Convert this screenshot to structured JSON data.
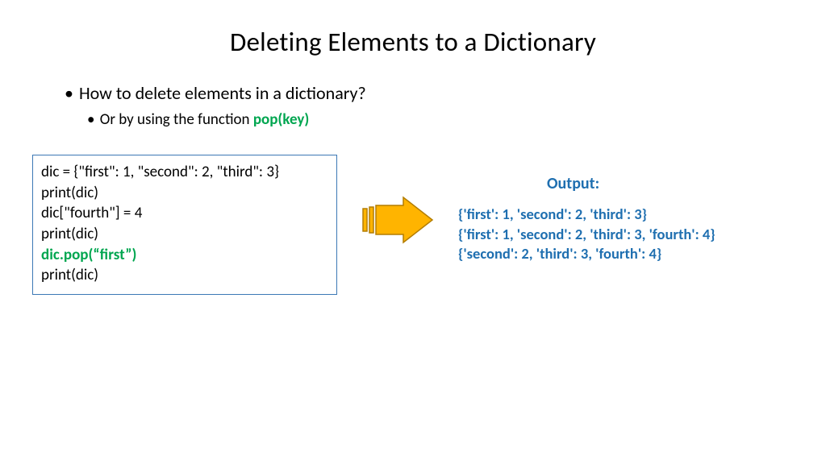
{
  "title": "Deleting Elements to a Dictionary",
  "bullets": {
    "main": "How to delete elements in a dictionary?",
    "sub_prefix": "Or by using the function ",
    "sub_fn": "pop(key)"
  },
  "code": {
    "line1": "dic = {\"first\": 1, \"second\": 2, \"third\": 3}",
    "line2": "print(dic)",
    "line3": "dic[\"fourth\"] = 4",
    "line4": "print(dic)",
    "line5": "dic.pop(“first”)",
    "line6": "print(dic)"
  },
  "output": {
    "label": "Output:",
    "line1": "{'first': 1, 'second': 2, 'third': 3}",
    "line2": "{'first': 1, 'second': 2, 'third': 3, 'fourth': 4}",
    "line3": "{'second': 2, 'third': 3, 'fourth': 4}"
  },
  "colors": {
    "green": "#00a650",
    "blue": "#1f6fb0",
    "arrow_fill": "#ffb400",
    "arrow_stroke": "#b37d00",
    "box_border": "#3c78b5"
  }
}
